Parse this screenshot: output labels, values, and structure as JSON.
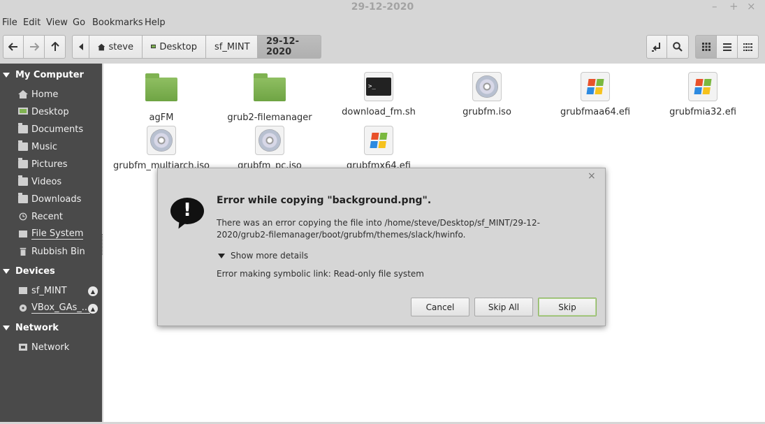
{
  "window": {
    "title": "29-12-2020"
  },
  "window_controls": {
    "minimize": "–",
    "maximize": "+",
    "close": "×"
  },
  "menu": [
    "File",
    "Edit",
    "View",
    "Go",
    "Bookmarks",
    "Help"
  ],
  "breadcrumbs": [
    "steve",
    "Desktop",
    "sf_MINT",
    "29-12-2020"
  ],
  "sidebar": {
    "sections": [
      {
        "title": "My Computer",
        "items": [
          "Home",
          "Desktop",
          "Documents",
          "Music",
          "Pictures",
          "Videos",
          "Downloads",
          "Recent",
          "File System",
          "Rubbish Bin"
        ]
      },
      {
        "title": "Devices",
        "items": [
          "sf_MINT",
          "VBox_GAs_..."
        ]
      },
      {
        "title": "Network",
        "items": [
          "Network"
        ]
      }
    ]
  },
  "files": [
    {
      "name": "agFM",
      "type": "folder"
    },
    {
      "name": "grub2-filemanager",
      "type": "folder"
    },
    {
      "name": "download_fm.sh",
      "type": "terminal"
    },
    {
      "name": "grubfm.iso",
      "type": "disc"
    },
    {
      "name": "grubfmaa64.efi",
      "type": "windows"
    },
    {
      "name": "grubfmia32.efi",
      "type": "windows"
    },
    {
      "name": "grubfm_multiarch.iso",
      "type": "disc"
    },
    {
      "name": "grubfm_pc.iso",
      "type": "disc"
    },
    {
      "name": "grubfmx64.efi",
      "type": "windows"
    }
  ],
  "terminal_prompt": ">_",
  "dialog": {
    "close": "×",
    "icon": "!",
    "title": "Error while copying \"background.png\".",
    "message": "There was an error copying the file into /home/steve/Desktop/sf_MINT/29-12-2020/grub2-filemanager/boot/grubfm/themes/slack/hwinfo.",
    "show_details": "Show more details",
    "detail": "Error making symbolic link: Read-only file system",
    "buttons": {
      "cancel": "Cancel",
      "skip_all": "Skip All",
      "skip": "Skip"
    }
  },
  "colors": {
    "sidebar_bg": "#4a4a4a",
    "folder_green": "#7fb251",
    "default_button_border": "#8cb55e"
  }
}
